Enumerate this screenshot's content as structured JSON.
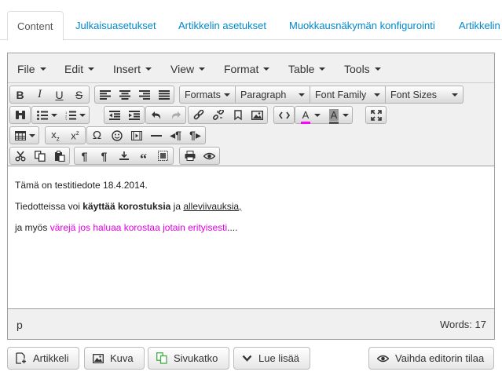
{
  "tabs": [
    {
      "label": "Content",
      "active": true
    },
    {
      "label": "Julkaisuasetukset"
    },
    {
      "label": "Artikkelin asetukset"
    },
    {
      "label": "Muokkausnäkymän konfigurointi"
    },
    {
      "label": "Artikkelin"
    }
  ],
  "menubar": {
    "file": "File",
    "edit": "Edit",
    "insert": "Insert",
    "view": "View",
    "format": "Format",
    "table": "Table",
    "tools": "Tools"
  },
  "toolbar": {
    "formats": "Formats",
    "paragraph": "Paragraph",
    "font_family": "Font Family",
    "font_sizes": "Font Sizes",
    "text_color": "#ff00ff",
    "icons_row1": [
      "bold-icon",
      "italic-icon",
      "underline-icon",
      "strikethrough-icon",
      "align-left-icon",
      "align-center-icon",
      "align-right-icon",
      "align-justify-icon"
    ],
    "icons_row2": [
      "find-icon",
      "bullet-list-icon",
      "numbered-list-icon",
      "outdent-icon",
      "indent-icon",
      "undo-icon",
      "redo-icon",
      "link-icon",
      "unlink-icon",
      "bookmark-icon",
      "image-icon",
      "code-icon",
      "text-color-icon",
      "background-color-icon",
      "fullscreen-icon"
    ],
    "icons_row3": [
      "table-icon",
      "subscript-icon",
      "superscript-icon",
      "special-character-icon",
      "emoticon-icon",
      "media-icon",
      "horizontal-rule-icon",
      "ltr-icon",
      "rtl-icon"
    ],
    "icons_row4": [
      "cut-icon",
      "copy-icon",
      "paste-icon",
      "show-blocks-icon",
      "visual-chars-icon",
      "insert-file-icon",
      "blockquote-icon",
      "template-icon",
      "print-icon",
      "preview-icon"
    ]
  },
  "content": {
    "p1": "Tämä on testitiedote 18.4.2014.",
    "p2_before": "Tiedotteissa voi ",
    "p2_bold": "käyttää korostuksia",
    "p2_mid": " ja ",
    "p2_underline": "alleviivauksia,",
    "p3_before": "ja myös ",
    "p3_colored": "värejä jos haluaa korostaa jotain erityisesti",
    "p3_after": "....",
    "highlight_color": "#e000e0"
  },
  "statusbar": {
    "path": "p",
    "words": "Words: 17"
  },
  "buttons": {
    "article": "Artikkeli",
    "image": "Kuva",
    "pagebreak": "Sivukatko",
    "readmore": "Lue lisää",
    "toggle_editor": "Vaihda editorin tilaa"
  }
}
